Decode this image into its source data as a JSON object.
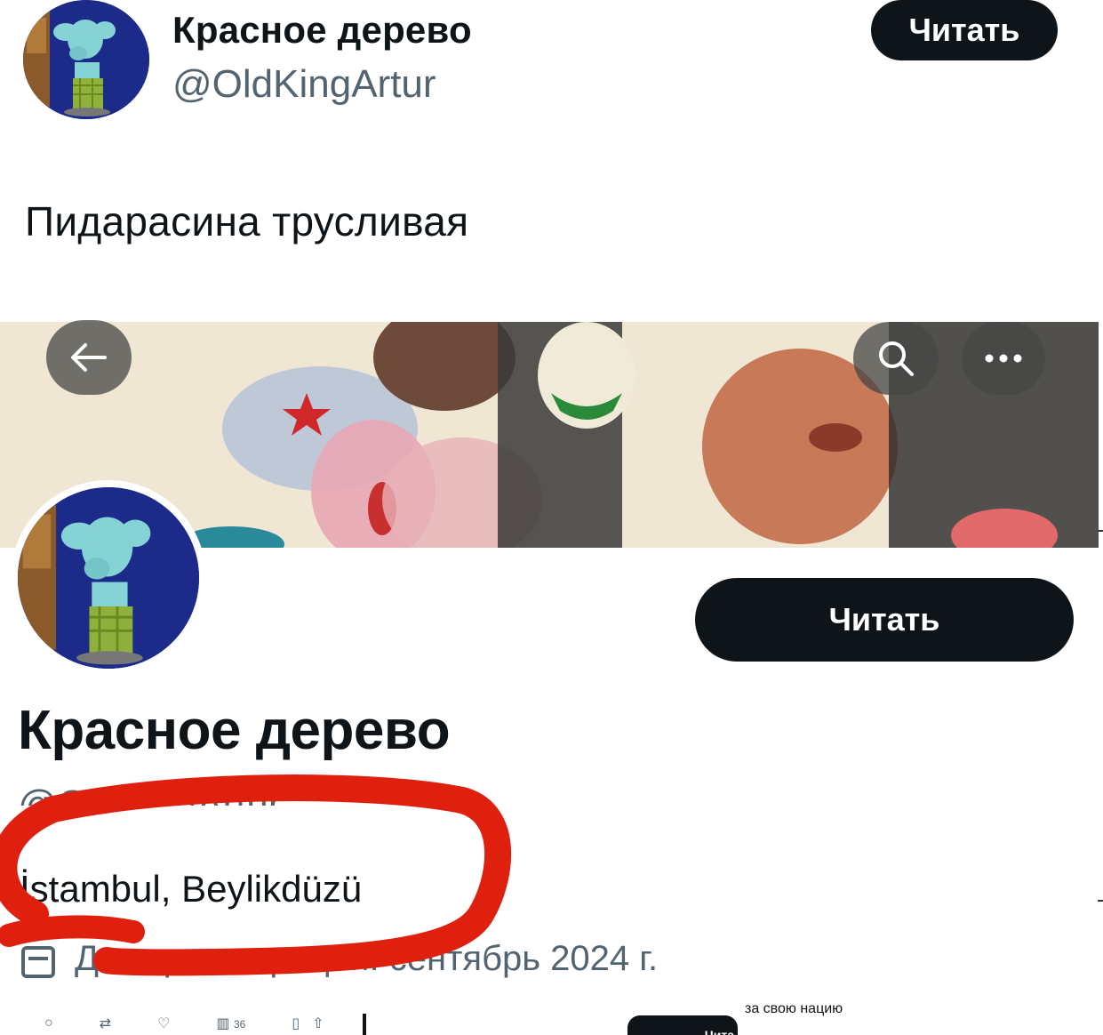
{
  "tweet": {
    "author_name": "Красное дерево",
    "author_handle": "@OldKingArtur",
    "follow_label": "Читать",
    "text": "Пидарасина трусливая"
  },
  "profile": {
    "name": "Красное дерево",
    "handle": "@OldKingArtur",
    "follow_label": "Читать",
    "location": "İstambul, Beylikdüzü",
    "joined": "Дата регистрации: сентябрь 2024 г.",
    "joined_visible": "сентябрь 2024 г.",
    "icons": {
      "back": "arrow-left-icon",
      "search": "search-icon",
      "more": "more-dots-icon",
      "calendar": "calendar-icon"
    }
  },
  "bottom_strip": {
    "views": "36",
    "follow_label": "Чита",
    "cropped_text": "за свою нацию"
  },
  "colors": {
    "follow_bg": "#0f1419",
    "secondary_text": "#536471",
    "annotation_red": "#e0200f",
    "avatar_bg": "#1c2a8a"
  }
}
